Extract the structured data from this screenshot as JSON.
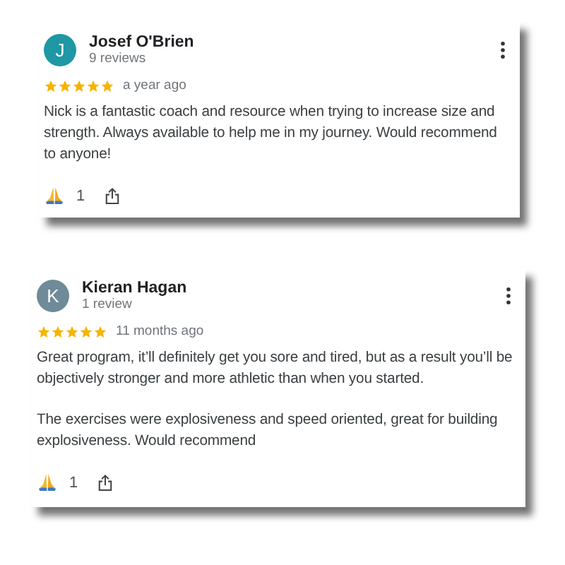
{
  "reviews": [
    {
      "initial": "J",
      "color": "#1f97a5",
      "name": "Josef O'Brien",
      "count": "9 reviews",
      "stars": 5,
      "time": "a year ago",
      "paragraphs": [
        "Nick is a fantastic coach and resource when trying to increase size and strength. Always available to help me in my journey. Would recommend to anyone!"
      ],
      "likes": "1"
    },
    {
      "initial": "K",
      "color": "#6f8a98",
      "name": "Kieran Hagan",
      "count": "1 review",
      "stars": 5,
      "time": "11 months ago",
      "paragraphs": [
        "Great program, it’ll definitely get you sore and tired, but as a result you’ll be objectively stronger and more athletic than when you started.",
        "The exercises were explosiveness and speed oriented, great for building explosiveness. Would recommend"
      ],
      "likes": "1"
    }
  ]
}
